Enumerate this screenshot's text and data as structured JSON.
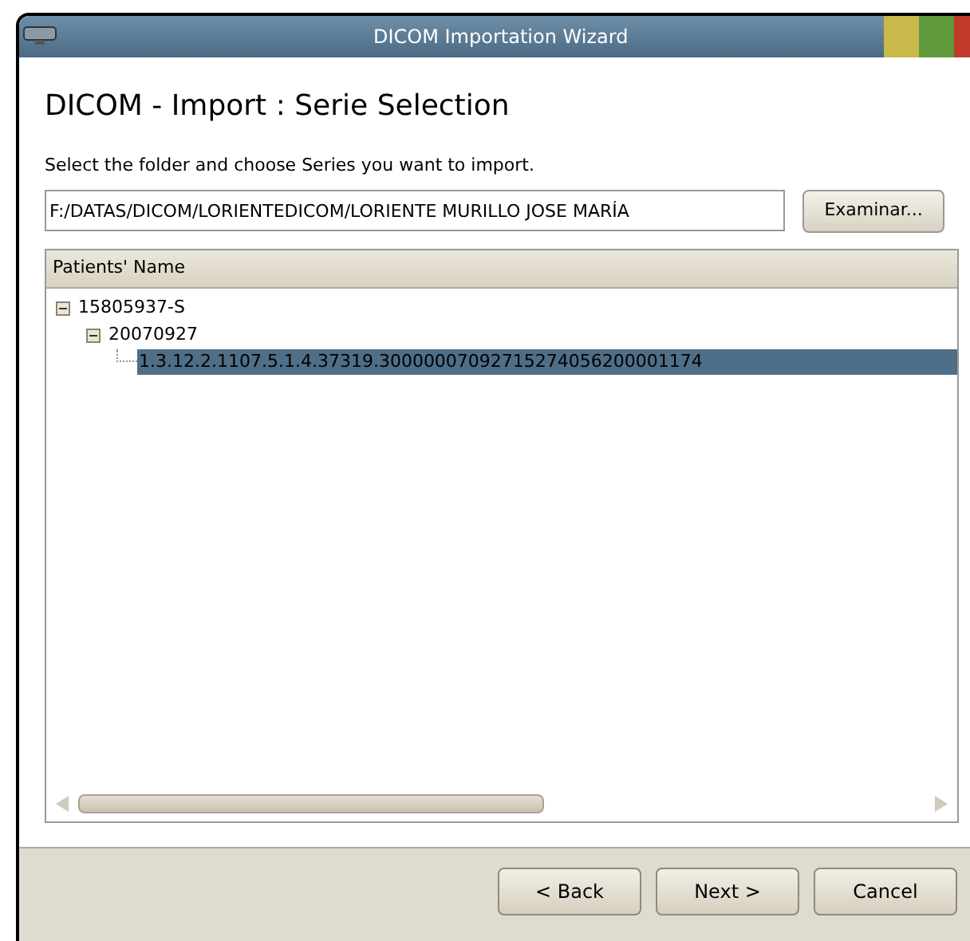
{
  "window": {
    "title": "DICOM Importation Wizard"
  },
  "heading": "DICOM - Import : Serie Selection",
  "instruction": "Select the folder and choose Series you want to import.",
  "folder": {
    "value": "F:/DATAS/DICOM/LORIENTEDICOM/LORIENTE MURILLO JOSE MARÍA",
    "button": "Examinar..."
  },
  "tree": {
    "column": "Patients' Name",
    "items": [
      {
        "label": "15805937-S",
        "expanded": true,
        "selected": false,
        "children": [
          {
            "label": "20070927",
            "expanded": true,
            "selected": false,
            "children": [
              {
                "label": "1.3.12.2.1107.5.1.4.37319.30000007092715274056200001174",
                "selected": true
              }
            ]
          }
        ]
      }
    ]
  },
  "buttons": [
    {
      "label": "< Back"
    },
    {
      "label": "Next >"
    },
    {
      "label": "Cancel"
    }
  ]
}
